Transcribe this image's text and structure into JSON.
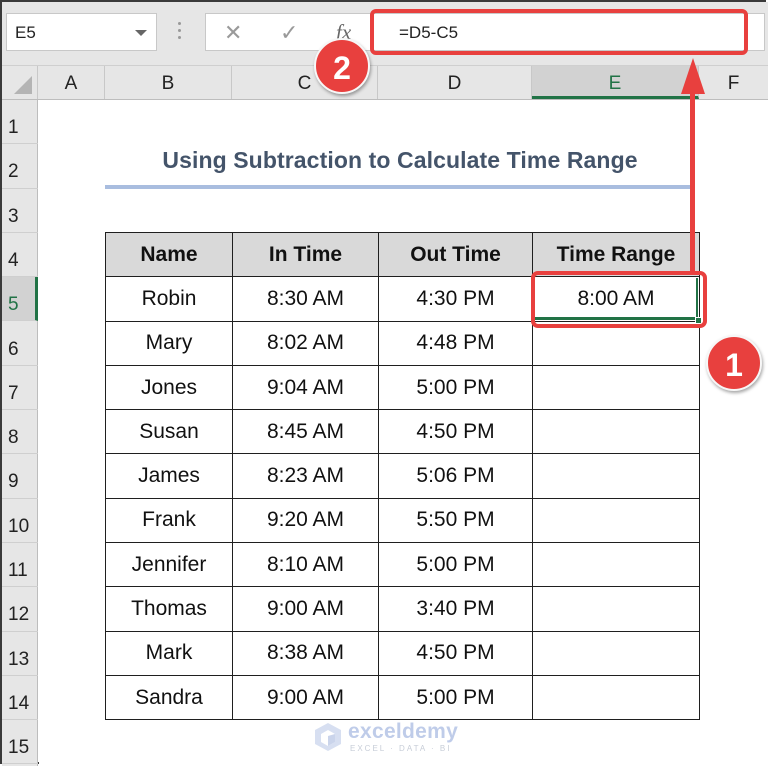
{
  "formula_bar": {
    "name_box": "E5",
    "cancel_icon": "✕",
    "enter_icon": "✓",
    "fx_label": "fx",
    "formula": "=D5-C5"
  },
  "columns": [
    {
      "label": "A",
      "selected": false
    },
    {
      "label": "B",
      "selected": false
    },
    {
      "label": "C",
      "selected": false
    },
    {
      "label": "D",
      "selected": false
    },
    {
      "label": "E",
      "selected": true
    },
    {
      "label": "F",
      "selected": false
    }
  ],
  "rows": [
    "1",
    "2",
    "3",
    "4",
    "5",
    "6",
    "7",
    "8",
    "9",
    "10",
    "11",
    "12",
    "13",
    "14",
    "15"
  ],
  "selected_row": "5",
  "sheet": {
    "title": "Using Subtraction to Calculate Time Range",
    "table": {
      "headers": [
        "Name",
        "In Time",
        "Out Time",
        "Time Range"
      ],
      "rows": [
        [
          "Robin",
          "8:30 AM",
          "4:30 PM",
          "8:00 AM"
        ],
        [
          "Mary",
          "8:02 AM",
          "4:48 PM",
          ""
        ],
        [
          "Jones",
          "9:04 AM",
          "5:00 PM",
          ""
        ],
        [
          "Susan",
          "8:45 AM",
          "4:50 PM",
          ""
        ],
        [
          "James",
          "8:23 AM",
          "5:06 PM",
          ""
        ],
        [
          "Frank",
          "9:20 AM",
          "5:50 PM",
          ""
        ],
        [
          "Jennifer",
          "8:10 AM",
          "5:00 PM",
          ""
        ],
        [
          "Thomas",
          "9:00 AM",
          "3:40 PM",
          ""
        ],
        [
          "Mark",
          "8:38 AM",
          "4:50 PM",
          ""
        ],
        [
          "Sandra",
          "9:00 AM",
          "5:00 PM",
          ""
        ]
      ]
    }
  },
  "annotations": {
    "badge_1": "1",
    "badge_2": "2",
    "highlight_color": "#e8403e"
  },
  "watermark": {
    "name": "exceldemy",
    "tagline": "EXCEL · DATA · BI"
  },
  "colors": {
    "selection_green": "#217346",
    "title_color": "#44546a",
    "header_fill": "#d9d9d9"
  }
}
